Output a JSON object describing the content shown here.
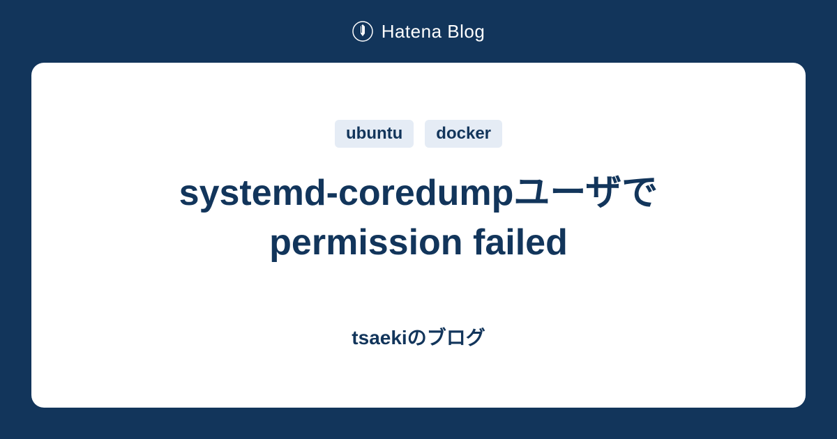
{
  "header": {
    "brand": "Hatena Blog"
  },
  "card": {
    "tags": [
      "ubuntu",
      "docker"
    ],
    "title": "systemd-coredumpユーザでpermission failed",
    "blog_name": "tsaekiのブログ"
  }
}
